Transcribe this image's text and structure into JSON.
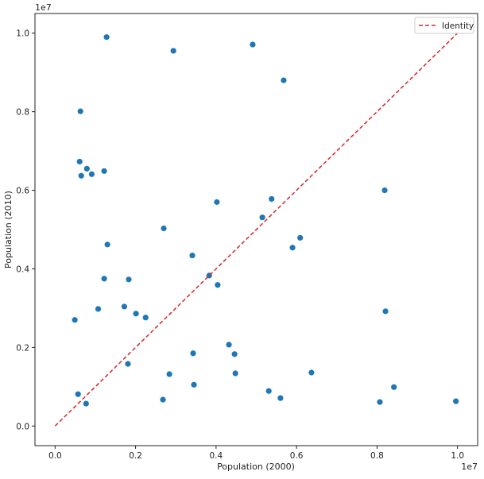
{
  "chart_data": {
    "type": "scatter",
    "title": "",
    "xlabel": "Population (2000)",
    "ylabel": "Population (2010)",
    "x_offset_label": "1e7",
    "y_offset_label": "1e7",
    "xlim": [
      -0.05,
      1.05
    ],
    "ylim": [
      -0.05,
      1.05
    ],
    "scale_multiplier": 10000000,
    "xticks": [
      0.0,
      0.2,
      0.4,
      0.6,
      0.8,
      1.0
    ],
    "xtick_labels": [
      "0.0",
      "0.2",
      "0.4",
      "0.6",
      "0.8",
      "1.0"
    ],
    "yticks": [
      0.0,
      0.2,
      0.4,
      0.6,
      0.8,
      1.0
    ],
    "ytick_labels": [
      "0.0",
      "0.2",
      "0.4",
      "0.6",
      "0.8",
      "1.0"
    ],
    "grid": false,
    "legend": {
      "position": "top-right",
      "entries": [
        {
          "label": "Identity",
          "style": "dashed",
          "color": "#d62728"
        }
      ]
    },
    "point_color": "#1f77b4",
    "identity_line": {
      "from": [
        0,
        0
      ],
      "to": [
        1.0,
        1.0
      ],
      "color": "#d62728"
    },
    "points": [
      [
        0.128,
        0.99
      ],
      [
        0.491,
        0.971
      ],
      [
        0.294,
        0.955
      ],
      [
        0.568,
        0.88
      ],
      [
        0.063,
        0.801
      ],
      [
        0.061,
        0.673
      ],
      [
        0.079,
        0.655
      ],
      [
        0.065,
        0.637
      ],
      [
        0.091,
        0.641
      ],
      [
        0.122,
        0.649
      ],
      [
        0.819,
        0.6
      ],
      [
        0.538,
        0.578
      ],
      [
        0.402,
        0.57
      ],
      [
        0.515,
        0.531
      ],
      [
        0.27,
        0.503
      ],
      [
        0.609,
        0.479
      ],
      [
        0.59,
        0.454
      ],
      [
        0.13,
        0.462
      ],
      [
        0.341,
        0.434
      ],
      [
        0.383,
        0.383
      ],
      [
        0.122,
        0.375
      ],
      [
        0.183,
        0.373
      ],
      [
        0.404,
        0.359
      ],
      [
        0.049,
        0.27
      ],
      [
        0.107,
        0.298
      ],
      [
        0.172,
        0.304
      ],
      [
        0.201,
        0.286
      ],
      [
        0.225,
        0.276
      ],
      [
        0.821,
        0.292
      ],
      [
        0.432,
        0.207
      ],
      [
        0.343,
        0.185
      ],
      [
        0.446,
        0.183
      ],
      [
        0.181,
        0.158
      ],
      [
        0.284,
        0.132
      ],
      [
        0.448,
        0.134
      ],
      [
        0.637,
        0.136
      ],
      [
        0.345,
        0.105
      ],
      [
        0.842,
        0.099
      ],
      [
        0.531,
        0.089
      ],
      [
        0.56,
        0.071
      ],
      [
        0.268,
        0.067
      ],
      [
        0.057,
        0.081
      ],
      [
        0.077,
        0.057
      ],
      [
        0.807,
        0.061
      ],
      [
        0.996,
        0.063
      ]
    ]
  }
}
